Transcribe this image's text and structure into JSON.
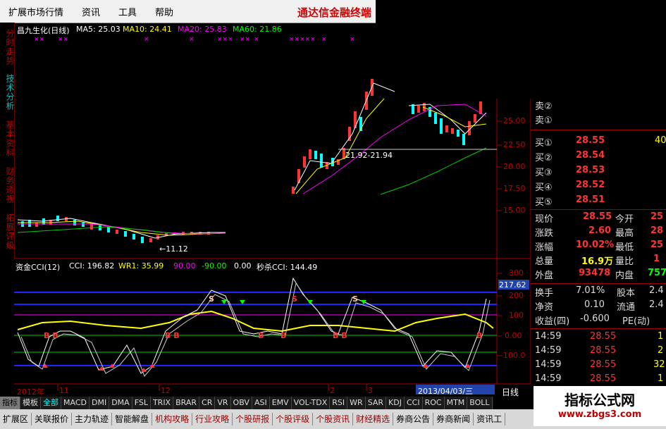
{
  "menu": {
    "items": [
      "扩展市场行情",
      "资讯",
      "工具",
      "帮助"
    ],
    "brand": "通达信金融终端"
  },
  "side_tabs": [
    {
      "label": "分时走势",
      "active": false
    },
    {
      "label": "技术分析",
      "active": true
    },
    {
      "label": "基本资料",
      "active": false
    },
    {
      "label": "财务透视",
      "active": false
    },
    {
      "label": "拓展评级",
      "active": false
    }
  ],
  "main_chart": {
    "stock": "昌九生化(日线)",
    "ma5": "MA5: 25.03",
    "ma10": "MA10: 24.41",
    "ma20": "MA20: 25.83",
    "ma60": "MA60: 21.86",
    "price_axis": [
      "25.00",
      "22.50",
      "20.00",
      "17.50",
      "15.00"
    ],
    "annotation_low": "←11.12",
    "annotation_range": "21.92-21.94",
    "colors": {
      "ma5": "#ffffff",
      "ma10": "#ffff00",
      "ma20": "#ff00ff",
      "ma60": "#00ff00",
      "up": "#ff3333",
      "down": "#00ffff"
    }
  },
  "indicator": {
    "name": "资金CCI(12)",
    "cci": "CCI: 196.82",
    "wr1": "WR1: 35.99",
    "v90": "90.00",
    "vneg90": "-90.00",
    "v0": "0.00",
    "miaosha": "秒杀CCI: 144.49",
    "axis": [
      "300",
      "200",
      "100",
      "0.00",
      "-100.0"
    ],
    "marker_value": "217.62"
  },
  "timeline": {
    "labels": [
      "2012年",
      "11",
      "12",
      "2",
      "3"
    ],
    "date_box": "2013/04/03/三",
    "period": "日线"
  },
  "quote": {
    "sell": [
      {
        "label": "卖②",
        "price": "",
        "vol": ""
      },
      {
        "label": "卖①",
        "price": "",
        "vol": ""
      }
    ],
    "buy": [
      {
        "label": "买①",
        "price": "28.55",
        "vol": "40"
      },
      {
        "label": "买②",
        "price": "28.54",
        "vol": ""
      },
      {
        "label": "买③",
        "price": "28.53",
        "vol": ""
      },
      {
        "label": "买④",
        "price": "28.52",
        "vol": ""
      },
      {
        "label": "买⑤",
        "price": "28.51",
        "vol": ""
      }
    ],
    "stats": [
      {
        "l1": "现价",
        "v1": "28.55",
        "l2": "今开",
        "v2": "25"
      },
      {
        "l1": "涨跌",
        "v1": "2.60",
        "l2": "最高",
        "v2": "28"
      },
      {
        "l1": "涨幅",
        "v1": "10.02%",
        "l2": "最低",
        "v2": "25"
      },
      {
        "l1": "总量",
        "v1": "16.9万",
        "l2": "量比",
        "v2": "1"
      },
      {
        "l1": "外盘",
        "v1": "93478",
        "l2": "内盘",
        "v2": "757"
      }
    ],
    "stats2": [
      {
        "l1": "换手",
        "v1": "7.01%",
        "l2": "股本",
        "v2": "2.4"
      },
      {
        "l1": "净资",
        "v1": "0.10",
        "l2": "流通",
        "v2": "2.4"
      },
      {
        "l1": "收益(四)",
        "v1": "-0.600",
        "l2": "PE(动)",
        "v2": ""
      }
    ],
    "ticks": [
      {
        "time": "14:59",
        "price": "28.55",
        "vol": "1"
      },
      {
        "time": "14:59",
        "price": "28.55",
        "vol": "2"
      },
      {
        "time": "14:59",
        "price": "28.55",
        "vol": "32"
      },
      {
        "time": "14:59",
        "price": "28.55",
        "vol": "1"
      }
    ]
  },
  "bottom_tabs": [
    "指标",
    "模板",
    "全部",
    "MACD",
    "DMI",
    "DMA",
    "FSL",
    "TRIX",
    "BRAR",
    "CR",
    "VR",
    "OBV",
    "ASI",
    "EMV",
    "VOL-TDX",
    "RSI",
    "WR",
    "SAR",
    "KDJ",
    "CCI",
    "ROC",
    "MTM",
    "BOLL"
  ],
  "bottom_tabs2": [
    "扩展区",
    "关联报价",
    "主力轨迹",
    "智能解盘",
    "机构攻略",
    "行业攻略",
    "个股研报",
    "个股评级",
    "个股资讯",
    "财经精选",
    "券商公告",
    "券商新闻",
    "资讯工"
  ],
  "watermark": {
    "title": "指标公式网",
    "url": "www.zbgs3.com"
  }
}
